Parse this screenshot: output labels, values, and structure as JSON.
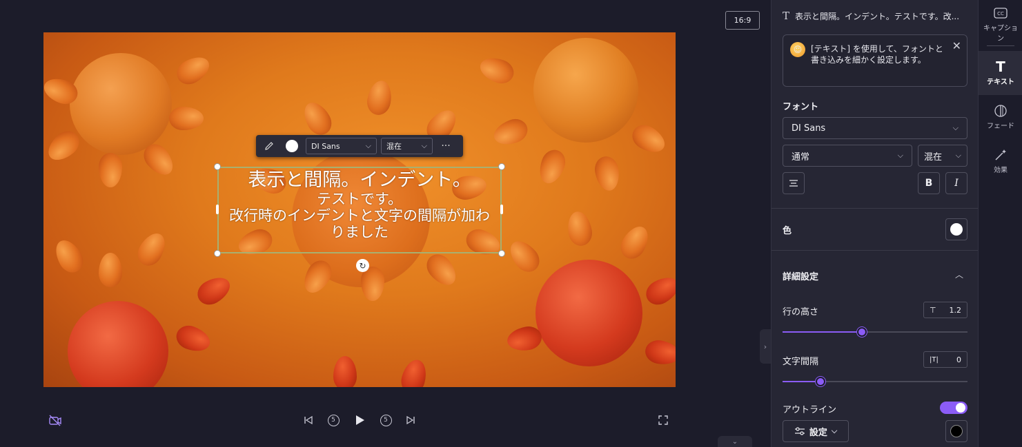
{
  "preview": {
    "aspect_ratio": "16:9",
    "toolbar": {
      "font": "DI Sans",
      "weight": "混在",
      "more": "···"
    },
    "caption": {
      "line1": "表示と間隔。インデント。",
      "line2": "テストです。",
      "line3": "改行時のインデントと文字の間隔が加わ",
      "line4": "りました"
    }
  },
  "playback": {
    "skip_back_label": "5",
    "skip_forward_label": "5"
  },
  "panel": {
    "header_title": "表示と間隔。インデント。テストです。改...",
    "tip_text": "[テキスト] を使用して、フォントと書き込みを細かく設定します。",
    "font_section": "フォント",
    "font_family": "DI Sans",
    "font_style": "通常",
    "font_weight": "混在",
    "bold_label": "B",
    "italic_label": "I",
    "color_section": "色",
    "text_color": "#ffffff",
    "advanced_section": "詳細設定",
    "line_height_label": "行の高さ",
    "line_height_value": "1.2",
    "line_height_fraction": 0.43,
    "letter_spacing_label": "文字間隔",
    "letter_spacing_value": "0",
    "letter_spacing_fraction": 0.2,
    "outline_label": "アウトライン",
    "outline_enabled": true,
    "outline_settings_label": "設定",
    "outline_color": "#000000"
  },
  "rail": {
    "items": [
      {
        "label": "キャプション",
        "icon": "cc-icon"
      },
      {
        "label": "テキスト",
        "icon": "text-icon"
      },
      {
        "label": "フェード",
        "icon": "fade-icon"
      },
      {
        "label": "効果",
        "icon": "magic-wand-icon"
      }
    ]
  },
  "colors": {
    "accent": "#8b5cf6",
    "panel_bg": "#262634",
    "app_bg": "#1c1c2a"
  }
}
